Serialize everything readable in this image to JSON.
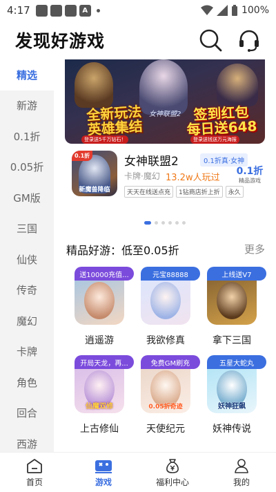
{
  "statusbar": {
    "time": "4:17",
    "battery": "100%"
  },
  "header": {
    "title": "发现好游戏",
    "search_icon": "search-icon",
    "service_icon": "headset-icon"
  },
  "sidebar": {
    "items": [
      {
        "label": "精选",
        "active": true
      },
      {
        "label": "新游"
      },
      {
        "label": "0.1折"
      },
      {
        "label": "0.05折"
      },
      {
        "label": "GM版"
      },
      {
        "label": "三国"
      },
      {
        "label": "仙侠"
      },
      {
        "label": "传奇"
      },
      {
        "label": "魔幻"
      },
      {
        "label": "卡牌"
      },
      {
        "label": "角色"
      },
      {
        "label": "回合"
      },
      {
        "label": "西游"
      }
    ]
  },
  "banner": {
    "left_text": "全新玩法\n英雄集结",
    "right_text": "签到红包\n每日送648",
    "left_tag": "登录送5千万钻石！",
    "right_tag": "登录送钱送万元海报",
    "logo": "女神联盟2"
  },
  "featured_game": {
    "badge": "0.1折",
    "icon_caption": "新魔兽降临",
    "name": "女神联盟2",
    "pill": "0.1折真·女神",
    "meta": "卡牌·魔幻",
    "players": "13.2w人玩过",
    "discount_value": "0.1折",
    "discount_label": "精品游戏",
    "tags": [
      "天天在线送点充",
      "1钻商店折上折",
      "永久"
    ]
  },
  "carousel": {
    "pages": 6,
    "active": 0
  },
  "section": {
    "title": "精品好游：低至0.05折",
    "more": "更多"
  },
  "games": [
    {
      "badge": "送10000充值...",
      "badge_color": "purple",
      "name": "逍遥游",
      "colors": [
        "#9cc3e6",
        "#f3d7c2"
      ]
    },
    {
      "badge": "元宝88888",
      "badge_color": "blue",
      "name": "我欲修真",
      "colors": [
        "#d9e6ff",
        "#f1e3ef"
      ]
    },
    {
      "badge": "上线送V7",
      "badge_color": "blue",
      "name": "拿下三国",
      "colors": [
        "#7b5a2e",
        "#d4a24a"
      ]
    },
    {
      "badge": "开局天龙，再...",
      "badge_color": "purple",
      "name": "上古修仙",
      "colors": [
        "#d5b8e8",
        "#f6e1ec"
      ]
    },
    {
      "badge": "免费GM刷充",
      "badge_color": "purple",
      "name": "天使纪元",
      "colors": [
        "#e9d3c5",
        "#fbeee6"
      ]
    },
    {
      "badge": "五星大蛇丸",
      "badge_color": "blue",
      "name": "妖神传说",
      "colors": [
        "#a9e1f5",
        "#e9f6fb"
      ]
    }
  ],
  "game_overlays": [
    "",
    "",
    "",
    "仙魔双修",
    "0.05折奇迹",
    "妖神狂飙"
  ],
  "bottom_nav": [
    {
      "label": "首页",
      "icon": "home-icon"
    },
    {
      "label": "游戏",
      "icon": "gamepad-icon",
      "active": true
    },
    {
      "label": "福利中心",
      "icon": "money-bag-icon"
    },
    {
      "label": "我的",
      "icon": "user-icon"
    }
  ],
  "colors": {
    "accent": "#3b6fe0",
    "orange": "#f07a1a",
    "badge_purple": "#7b4bdc"
  }
}
